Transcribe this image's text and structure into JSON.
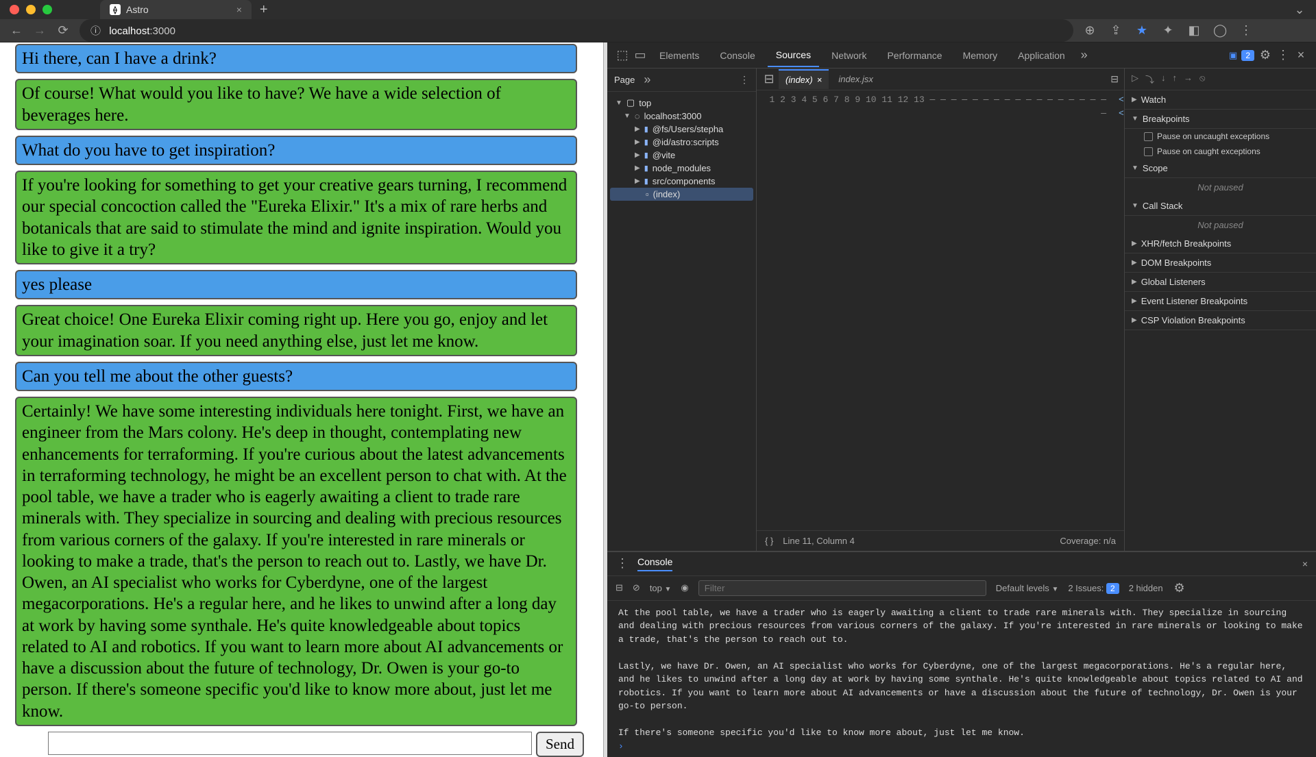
{
  "browser": {
    "tab_title": "Astro",
    "url_host": "localhost",
    "url_port": ":3000"
  },
  "chat": {
    "messages": [
      {
        "role": "user",
        "text": "Hi there, can I have a drink?"
      },
      {
        "role": "bot",
        "text": "Of course! What would you like to have? We have a wide selection of beverages here."
      },
      {
        "role": "user",
        "text": "What do you have to get inspiration?"
      },
      {
        "role": "bot",
        "text": "If you're looking for something to get your creative gears turning, I recommend our special concoction called the \"Eureka Elixir.\" It's a mix of rare herbs and botanicals that are said to stimulate the mind and ignite inspiration. Would you like to give it a try?"
      },
      {
        "role": "user",
        "text": "yes please"
      },
      {
        "role": "bot",
        "text": "Great choice! One Eureka Elixir coming right up. Here you go, enjoy and let your imagination soar. If you need anything else, just let me know."
      },
      {
        "role": "user",
        "text": "Can you tell me about the other guests?"
      },
      {
        "role": "bot",
        "text": "Certainly! We have some interesting individuals here tonight. First, we have an engineer from the Mars colony. He's deep in thought, contemplating new enhancements for terraforming. If you're curious about the latest advancements in terraforming technology, he might be an excellent person to chat with. At the pool table, we have a trader who is eagerly awaiting a client to trade rare minerals with. They specialize in sourcing and dealing with precious resources from various corners of the galaxy. If you're interested in rare minerals or looking to make a trade, that's the person to reach out to. Lastly, we have Dr. Owen, an AI specialist who works for Cyberdyne, one of the largest megacorporations. He's a regular here, and he likes to unwind after a long day at work by having some synthale. He's quite knowledgeable about topics related to AI and robotics. If you want to learn more about AI advancements or have a discussion about the future of technology, Dr. Owen is your go-to person. If there's someone specific you'd like to know more about, just let me know."
      }
    ],
    "send_label": "Send"
  },
  "devtools": {
    "tabs": [
      "Elements",
      "Console",
      "Sources",
      "Network",
      "Performance",
      "Memory",
      "Application"
    ],
    "active_tab": "Sources",
    "issues_count": "2",
    "page_label": "Page",
    "file_tree": {
      "top": "top",
      "host": "localhost:3000",
      "folders": [
        "@fs/Users/stepha",
        "@id/astro:scripts",
        "@vite",
        "node_modules",
        "src/components"
      ],
      "file": "(index)"
    },
    "open_files": [
      "(index)",
      "index.jsx"
    ],
    "active_file": "(index)",
    "gutter": "1\n2\n3\n4\n5\n6\n7\n8\n9\n10\n11\n12\n13\n—\n—\n—\n—\n—\n—\n—\n—\n—\n—\n—\n—\n—\n—\n—\n—\n—\n—",
    "status": {
      "pos": "Line 11, Column 4",
      "coverage": "Coverage: n/a"
    },
    "debugger": {
      "watch": "Watch",
      "breakpoints": "Breakpoints",
      "bp1": "Pause on uncaught exceptions",
      "bp2": "Pause on caught exceptions",
      "scope": "Scope",
      "not_paused": "Not paused",
      "callstack": "Call Stack",
      "xhr": "XHR/fetch Breakpoints",
      "dom": "DOM Breakpoints",
      "global": "Global Listeners",
      "event": "Event Listener Breakpoints",
      "csp": "CSP Violation Breakpoints"
    },
    "console": {
      "title": "Console",
      "context": "top",
      "filter_placeholder": "Filter",
      "levels": "Default levels",
      "issues_label": "2 Issues:",
      "issues_badge": "2",
      "hidden": "2 hidden",
      "log": "At the pool table, we have a trader who is eagerly awaiting a client to trade rare minerals with. They specialize in sourcing and dealing with precious resources from various corners of the galaxy. If you're interested in rare minerals or looking to make a trade, that's the person to reach out to.\n\nLastly, we have Dr. Owen, an AI specialist who works for Cyberdyne, one of the largest megacorporations. He's a regular here, and he likes to unwind after a long day at work by having some synthale. He's quite knowledgeable about topics related to AI and robotics. If you want to learn more about AI advancements or have a discussion about the future of technology, Dr. Owen is your go-to person.\n\nIf there's someone specific you'd like to know more about, just let me know."
    }
  }
}
